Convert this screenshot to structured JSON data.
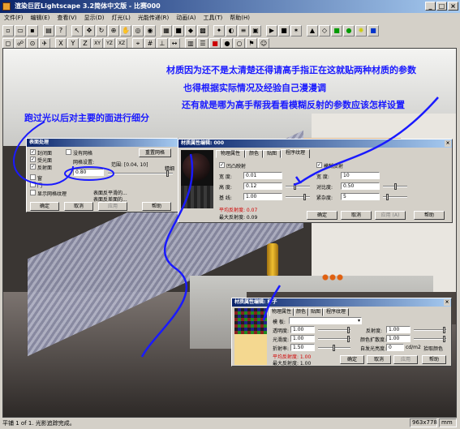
{
  "window": {
    "title": "渲染巨匠Lightscape 3.2简体中文版 - 比赛000",
    "min": "_",
    "max": "□",
    "close": "×"
  },
  "menu": [
    "文件(F)",
    "编辑(E)",
    "查看(V)",
    "显示(D)",
    "灯光(L)",
    "光能传递(R)",
    "动画(A)",
    "工具(T)",
    "帮助(H)"
  ],
  "toolbar_row2_labels": [
    "X",
    "Y",
    "Z",
    "XY",
    "YZ",
    "XZ"
  ],
  "annotations": {
    "line1": "材质因为还不是太清楚还得请高手指正在这就贴两种材质的参数",
    "line2": "也得根据实际情况及经验自己漫漫调",
    "line3": "还有就是哪为高手帮我看看模糊反射的参数应该怎样设置",
    "left": "跑过光以后对主要的面进行细分"
  },
  "surface_dialog": {
    "title": "表面处理",
    "checks": [
      {
        "label": "封闭面",
        "checked": true
      },
      {
        "label": "受光面",
        "checked": true
      },
      {
        "label": "反射面",
        "checked": true
      }
    ],
    "no_mesh": "没有网格",
    "remesh_button": "重置网格",
    "mesh_settings": "网格设置:",
    "range": "范围: [0.04, 10]",
    "value": "0.80",
    "precision": "精细",
    "rough": "粗",
    "window_check": "窗",
    "door_check": "门",
    "show_mesh": "显示网格纹理",
    "surface_front": "表面反平滑的...",
    "surface_interp": "表面反差面的...",
    "ok": "确定",
    "cancel": "取消",
    "apply": "应用",
    "help": "帮助"
  },
  "material_dialog_1": {
    "title": "材质属性编辑: 000",
    "tabs": [
      "物理属性",
      "颜色",
      "贴图",
      "程序纹理"
    ],
    "bump": "凹凸映射",
    "blur": "模糊反射",
    "width_label": "宽 度:",
    "width_value": "0.01",
    "height_label": "高 度:",
    "height_value": "0.12",
    "noise_label": "基 线:",
    "noise_value": "1.00",
    "w2_label": "宽 度:",
    "w2_value": "10",
    "contrast_label": "对比度:",
    "contrast_value": "0.50",
    "smooth_label": "紧杂度:",
    "smooth_value": "5",
    "avg_reflect": "平均反射度: 0.07",
    "max_reflect": "最大反射度: 0.09",
    "ok": "确定",
    "cancel": "取消",
    "apply": "应用 (A)",
    "help": "帮助"
  },
  "material_dialog_2": {
    "title": "材质属性编辑: 杯子",
    "tabs": [
      "物理属性",
      "颜色",
      "贴图",
      "程序纹理"
    ],
    "template_label": "模 板:",
    "transparency_label": "透明度:",
    "transparency_value": "1.00",
    "reflect_label": "反射度:",
    "reflect_value": "1.00",
    "smoothness_label": "光滑度:",
    "smoothness_value": "1.00",
    "refraction_label": "折射率:",
    "refraction_value": "1.50",
    "color_reflect_label": "颜色扩散度:",
    "color_reflect_value": "1.00",
    "self_light_label": "自发光亮度:",
    "self_light_value": "0",
    "self_light_unit": "cd/m2",
    "pick_color": "拾取颜色",
    "avg_reflect": "平均反射度: 1.00",
    "max_reflect": "最大反射度: 1.00",
    "ok": "确定",
    "cancel": "取消",
    "apply": "应用",
    "help": "帮助"
  },
  "status": {
    "text": "平铺 1 of 1. 光影追踪完成。",
    "dims": "963x778",
    "unit": "mm"
  }
}
